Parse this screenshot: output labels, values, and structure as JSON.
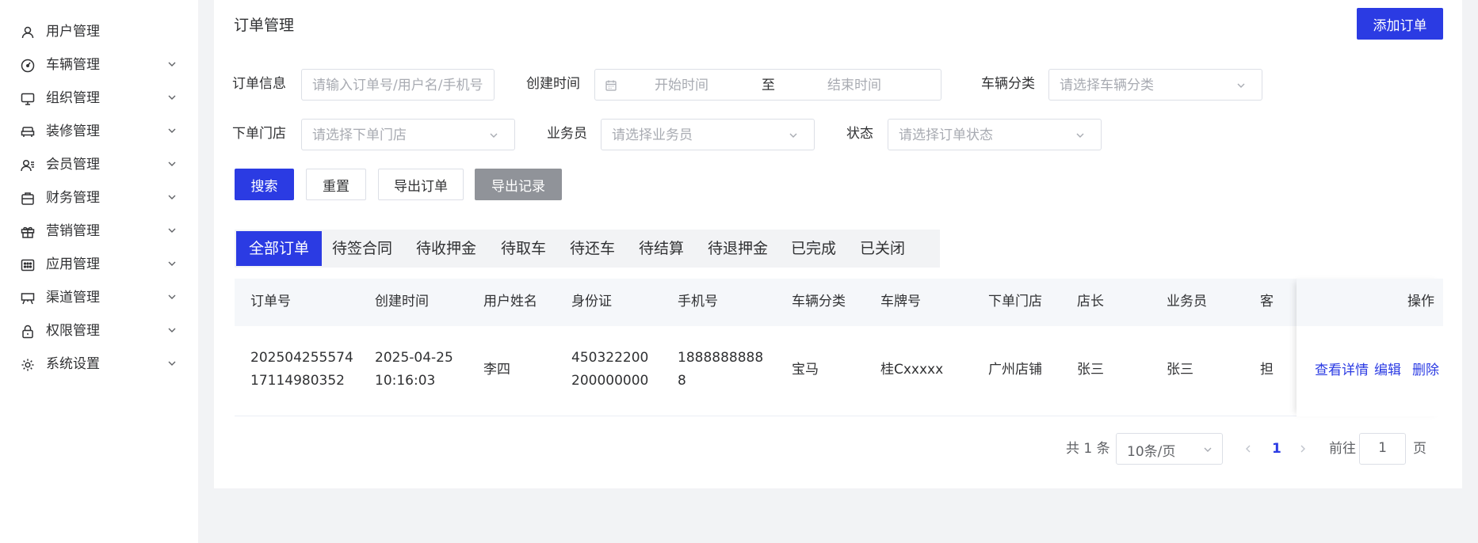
{
  "sidebar": {
    "items": [
      {
        "label": "用户管理",
        "icon": "user-icon"
      },
      {
        "label": "车辆管理",
        "icon": "gauge-icon"
      },
      {
        "label": "组织管理",
        "icon": "monitor-icon"
      },
      {
        "label": "装修管理",
        "icon": "sofa-icon"
      },
      {
        "label": "会员管理",
        "icon": "member-icon"
      },
      {
        "label": "财务管理",
        "icon": "wallet-icon"
      },
      {
        "label": "营销管理",
        "icon": "gift-icon"
      },
      {
        "label": "应用管理",
        "icon": "apps-icon"
      },
      {
        "label": "渠道管理",
        "icon": "channel-icon"
      },
      {
        "label": "权限管理",
        "icon": "lock-icon"
      },
      {
        "label": "系统设置",
        "icon": "gear-icon"
      }
    ]
  },
  "page": {
    "title": "订单管理",
    "add_button": "添加订单"
  },
  "filters": {
    "order_info": {
      "label": "订单信息",
      "placeholder": "请输入订单号/用户名/手机号"
    },
    "created_time": {
      "label": "创建时间",
      "start_placeholder": "开始时间",
      "separator": "至",
      "end_placeholder": "结束时间"
    },
    "vehicle_category": {
      "label": "车辆分类",
      "placeholder": "请选择车辆分类"
    },
    "store": {
      "label": "下单门店",
      "placeholder": "请选择下单门店"
    },
    "salesperson": {
      "label": "业务员",
      "placeholder": "请选择业务员"
    },
    "status": {
      "label": "状态",
      "placeholder": "请选择订单状态"
    }
  },
  "actions": {
    "search": "搜索",
    "reset": "重置",
    "export_orders": "导出订单",
    "export_records": "导出记录"
  },
  "tabs": [
    "全部订单",
    "待签合同",
    "待收押金",
    "待取车",
    "待还车",
    "待结算",
    "待退押金",
    "已完成",
    "已关闭"
  ],
  "table": {
    "headers": {
      "order_no": "订单号",
      "created": "创建时间",
      "user_name": "用户姓名",
      "id_card": "身份证",
      "phone": "手机号",
      "category": "车辆分类",
      "plate": "车牌号",
      "store": "下单门店",
      "manager": "店长",
      "salesperson": "业务员",
      "truncated": "客",
      "operations": "操作"
    },
    "rows": [
      {
        "order_no_1": "202504255574",
        "order_no_2": "17114980352",
        "created_1": "2025-04-25",
        "created_2": "10:16:03",
        "user_name": "李四",
        "id_card_1": "450322200",
        "id_card_2": "200000000",
        "phone_1": "1888888888",
        "phone_2": "8",
        "category": "宝马",
        "plate": "桂Cxxxxx",
        "store": "广州店铺",
        "manager": "张三",
        "salesperson": "张三",
        "truncated": "担",
        "op_view": "查看详情",
        "op_edit": "编辑",
        "op_delete": "删除"
      }
    ]
  },
  "pagination": {
    "total": "共 1 条",
    "page_size": "10条/页",
    "current_page": "1",
    "goto_prefix": "前往",
    "goto_value": "1",
    "goto_suffix": "页"
  }
}
